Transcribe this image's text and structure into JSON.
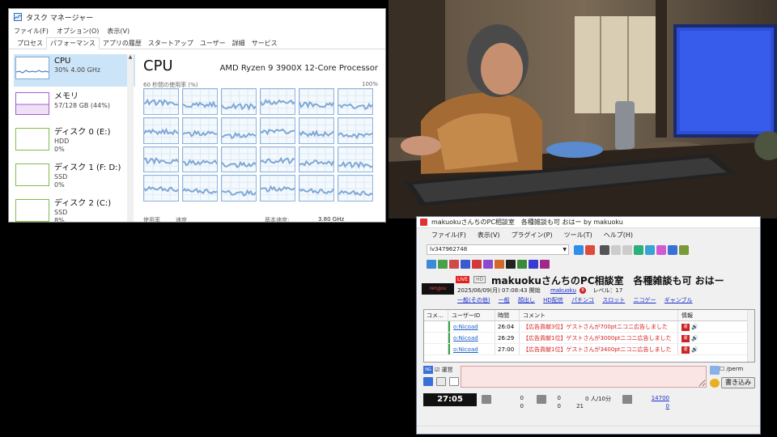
{
  "task_manager": {
    "title": "タスク マネージャー",
    "menu": [
      "ファイル(F)",
      "オプション(O)",
      "表示(V)"
    ],
    "tabs": [
      "プロセス",
      "パフォーマンス",
      "アプリの履歴",
      "スタートアップ",
      "ユーザー",
      "詳細",
      "サービス"
    ],
    "active_tab": "パフォーマンス",
    "resources": [
      {
        "name": "CPU",
        "sub1": "30% 4.00 GHz",
        "sub2": ""
      },
      {
        "name": "メモリ",
        "sub1": "57/128 GB (44%)",
        "sub2": ""
      },
      {
        "name": "ディスク 0 (E:)",
        "sub1": "HDD",
        "sub2": "0%"
      },
      {
        "name": "ディスク 1 (F: D:)",
        "sub1": "SSD",
        "sub2": "0%"
      },
      {
        "name": "ディスク 2 (C:)",
        "sub1": "SSD",
        "sub2": "8%"
      }
    ],
    "cpu_title": "CPU",
    "processor": "AMD Ryzen 9 3900X 12-Core Processor",
    "usage_label": "60 秒間の使用率 (%)",
    "pct_max": "100%",
    "footer": {
      "usage": "使用率",
      "speed": "速度",
      "base_speed_label": "基本速度:",
      "base_speed_value": "3.80 GHz"
    },
    "core_count": 24,
    "colors": {
      "cpu": "#7fa8d6",
      "memory": "#a65ecc",
      "disk": "#7cbf4b",
      "selected": "#cce4f7"
    }
  },
  "comment_viewer": {
    "title": "makuokuさんちのPC相談室　各種雑談も可 おはー by makuoku",
    "menu": [
      "ファイル(F)",
      "表示(V)",
      "プラグイン(P)",
      "ツール(T)",
      "ヘルプ(H)"
    ],
    "broadcast_id": "lv347962748",
    "live_label": "LIVE",
    "hd_label": "HD",
    "broadcast_title": "makuokuさんちのPC相談室　各種雑談も可 おはー",
    "start_time": "2025/06/09(月) 07:08:43 開始",
    "owner": "makuoku",
    "level": "レベル：17",
    "tags": [
      "一般(その他)",
      "一般",
      "顔出し",
      "HD配信",
      "パチンコ",
      "スロット",
      "ニコゲー",
      "ギャンブル"
    ],
    "columns": [
      "コメ...",
      "ユーザーID",
      "時間",
      "コメント",
      "情報"
    ],
    "comments": [
      {
        "no": "",
        "user": "o:Nicoad",
        "time": "26:04",
        "text": "【広告貢献3位】ゲストさんが700ptニコニ広告しました"
      },
      {
        "no": "",
        "user": "o:Nicoad",
        "time": "26:29",
        "text": "【広告貢献1位】ゲストさんが3000ptニコニ広告しました"
      },
      {
        "no": "",
        "user": "o:Nicoad",
        "time": "27:00",
        "text": "【広告貢献1位】ゲストさんが3400ptニコニ広告しました"
      }
    ],
    "unei_label": "運営",
    "perm_label": "/perm",
    "submit_label": "書き込み",
    "elapsed": "27:05",
    "stats": {
      "a1": "0",
      "a2": "0",
      "b1": "0",
      "b2": "0",
      "rate": "0 人/10分",
      "c2": "21",
      "total": "14700",
      "total2": "0"
    }
  }
}
